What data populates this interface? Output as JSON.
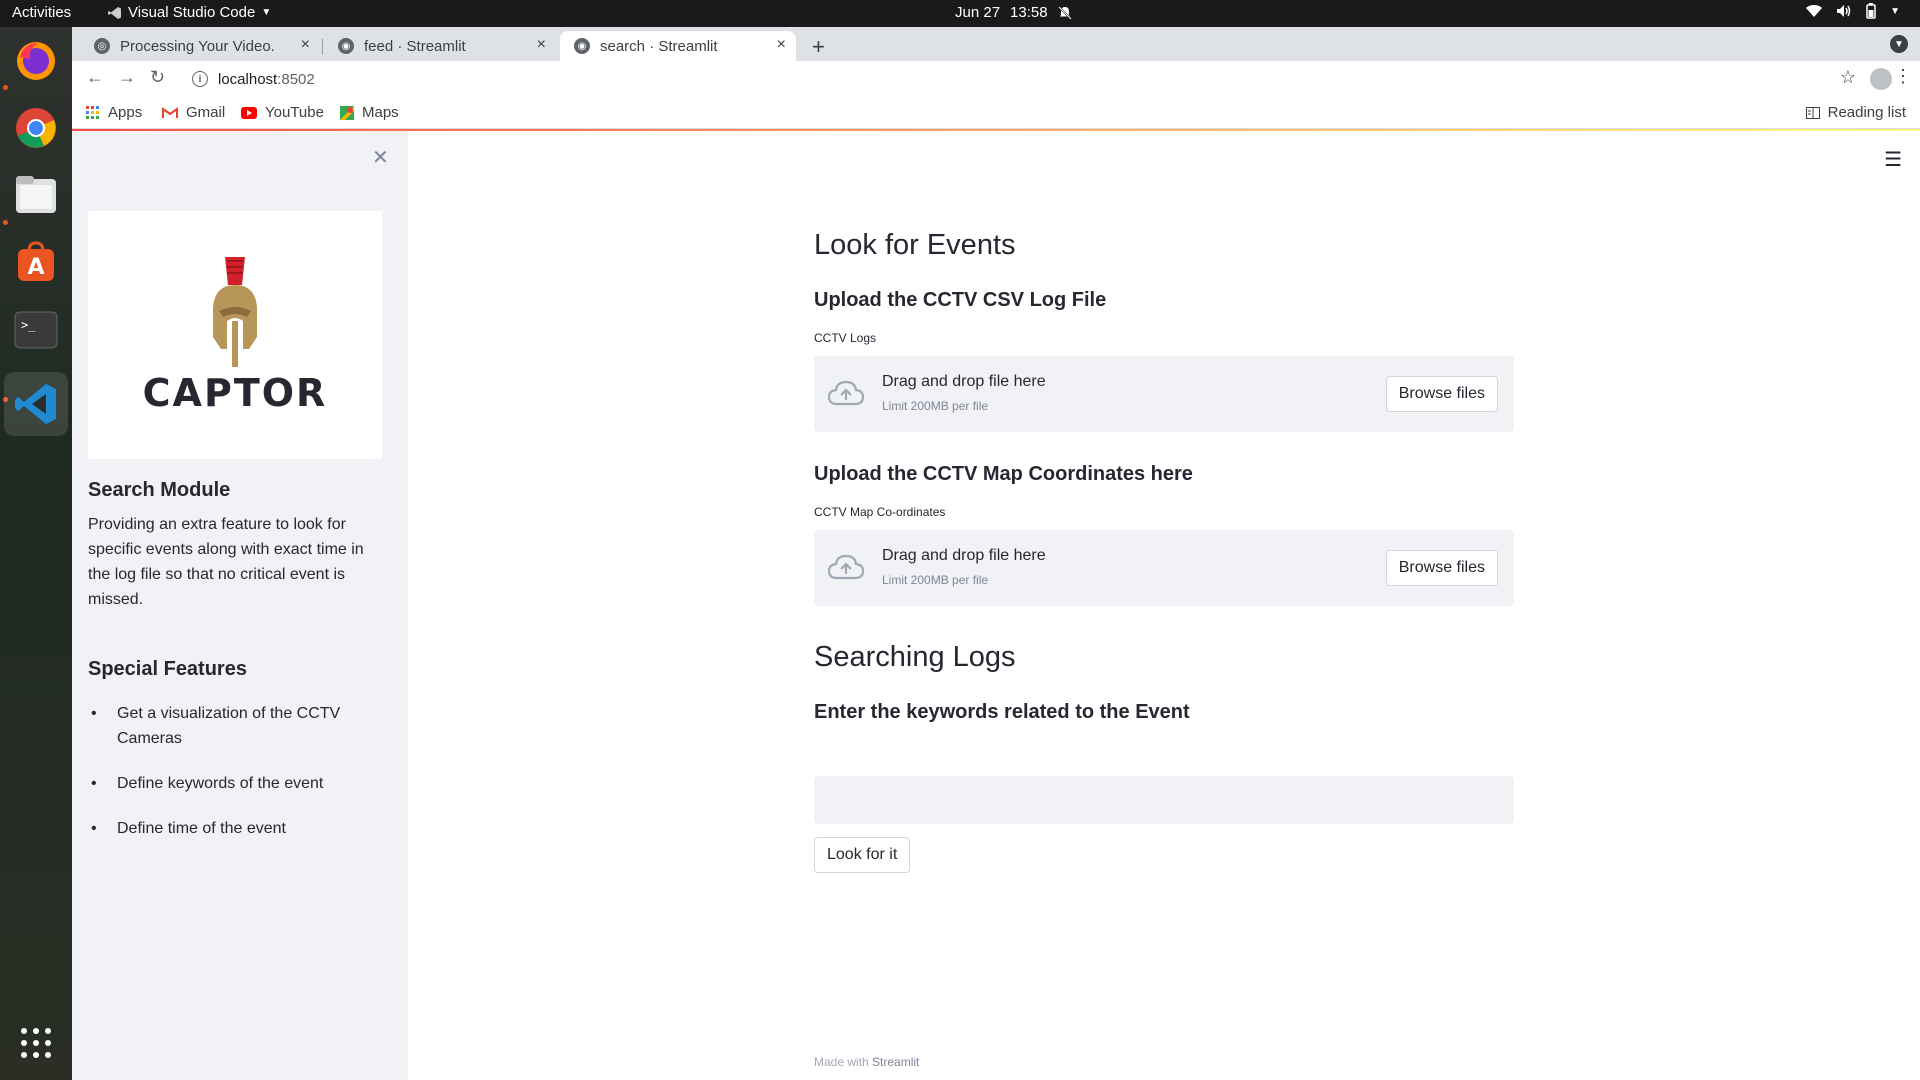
{
  "system_bar": {
    "activities": "Activities",
    "app_name": "Visual Studio Code",
    "date": "Jun 27",
    "time": "13:58"
  },
  "dock": {
    "apps": [
      "firefox-icon",
      "chrome-icon",
      "files-icon",
      "software-center-icon",
      "terminal-icon",
      "vscode-icon"
    ]
  },
  "browser": {
    "tabs": [
      {
        "title": "Processing Your Video."
      },
      {
        "title": "feed · Streamlit"
      },
      {
        "title": "search · Streamlit"
      }
    ],
    "url_host": "localhost",
    "url_port": ":8502",
    "bookmarks": [
      "Apps",
      "Gmail",
      "YouTube",
      "Maps"
    ],
    "reading_list": "Reading list"
  },
  "sidebar": {
    "logo_text": "CAPTOR",
    "search_module_title": "Search Module",
    "search_module_desc": "Providing an extra feature to look for specific events along with exact time in the log file so that no critical event is missed.",
    "special_features_title": "Special Features",
    "features": [
      "Get a visualization of the CCTV Cameras",
      "Define keywords of the event",
      "Define time of the event"
    ]
  },
  "main": {
    "title": "Look for Events",
    "upload_csv_heading": "Upload the CCTV CSV Log File",
    "csv_label": "CCTV Logs",
    "upload_map_heading": "Upload the CCTV Map Coordinates here",
    "map_label": "CCTV Map Co-ordinates",
    "dropzone_title": "Drag and drop file here",
    "dropzone_limit": "Limit 200MB per file",
    "browse_label": "Browse files",
    "searching_title": "Searching Logs",
    "keywords_heading": "Enter the keywords related to the Event",
    "keywords_value": "",
    "look_button": "Look for it",
    "footer_prefix": "Made with",
    "footer_brand": "Streamlit"
  }
}
